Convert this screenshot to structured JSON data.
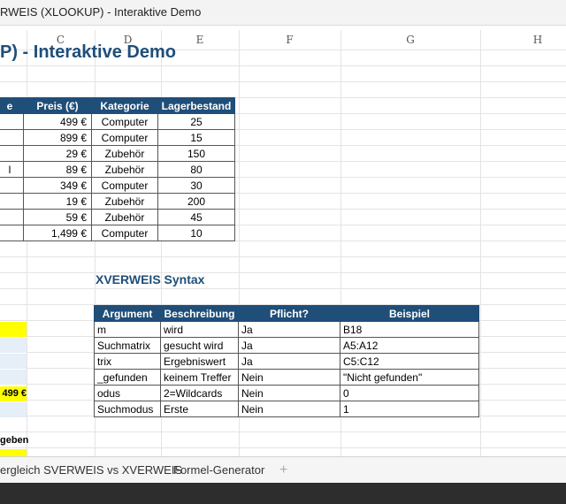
{
  "window": {
    "title": "RWEIS (XLOOKUP) - Interaktive Demo"
  },
  "columns": [
    "C",
    "D",
    "E",
    "F",
    "G",
    "H"
  ],
  "sheet": {
    "title": "P) - Interaktive Demo"
  },
  "products": {
    "headers": [
      "e",
      "Preis (€)",
      "Kategorie",
      "Lagerbestand"
    ],
    "rows": [
      [
        "",
        "499 €",
        "Computer",
        "25"
      ],
      [
        "",
        "899 €",
        "Computer",
        "15"
      ],
      [
        "",
        "29 €",
        "Zubehör",
        "150"
      ],
      [
        "l",
        "89 €",
        "Zubehör",
        "80"
      ],
      [
        "",
        "349 €",
        "Computer",
        "30"
      ],
      [
        "",
        "19 €",
        "Zubehör",
        "200"
      ],
      [
        "",
        "59 €",
        "Zubehör",
        "45"
      ],
      [
        "",
        "1,499 €",
        "Computer",
        "10"
      ]
    ]
  },
  "syntax": {
    "title": "XVERWEIS Syntax",
    "headers": [
      "Argument",
      "Beschreibung",
      "Pflicht?",
      "Beispiel"
    ],
    "rows": [
      [
        "m",
        "wird",
        "Ja",
        "B18"
      ],
      [
        "Suchmatrix",
        "gesucht wird",
        "Ja",
        "A5:A12"
      ],
      [
        "trix",
        "Ergebniswert",
        "Ja",
        "C5:C12"
      ],
      [
        "_gefunden",
        "keinem Treffer",
        "Nein",
        "\"Nicht gefunden\""
      ],
      [
        "odus",
        "2=Wildcards",
        "Nein",
        "0"
      ],
      [
        "Suchmodus",
        "Erste",
        "Nein",
        "1"
      ]
    ]
  },
  "left": {
    "result": "499 €",
    "label": "geben"
  },
  "tabs": [
    "ergleich SVERWEIS vs XVERWEIS",
    "Formel-Generator"
  ],
  "add_tab": "+",
  "colors": {
    "header_blue": "#1f4e79",
    "highlight_yellow": "#ffff00",
    "input_blue": "#e6eef7"
  }
}
